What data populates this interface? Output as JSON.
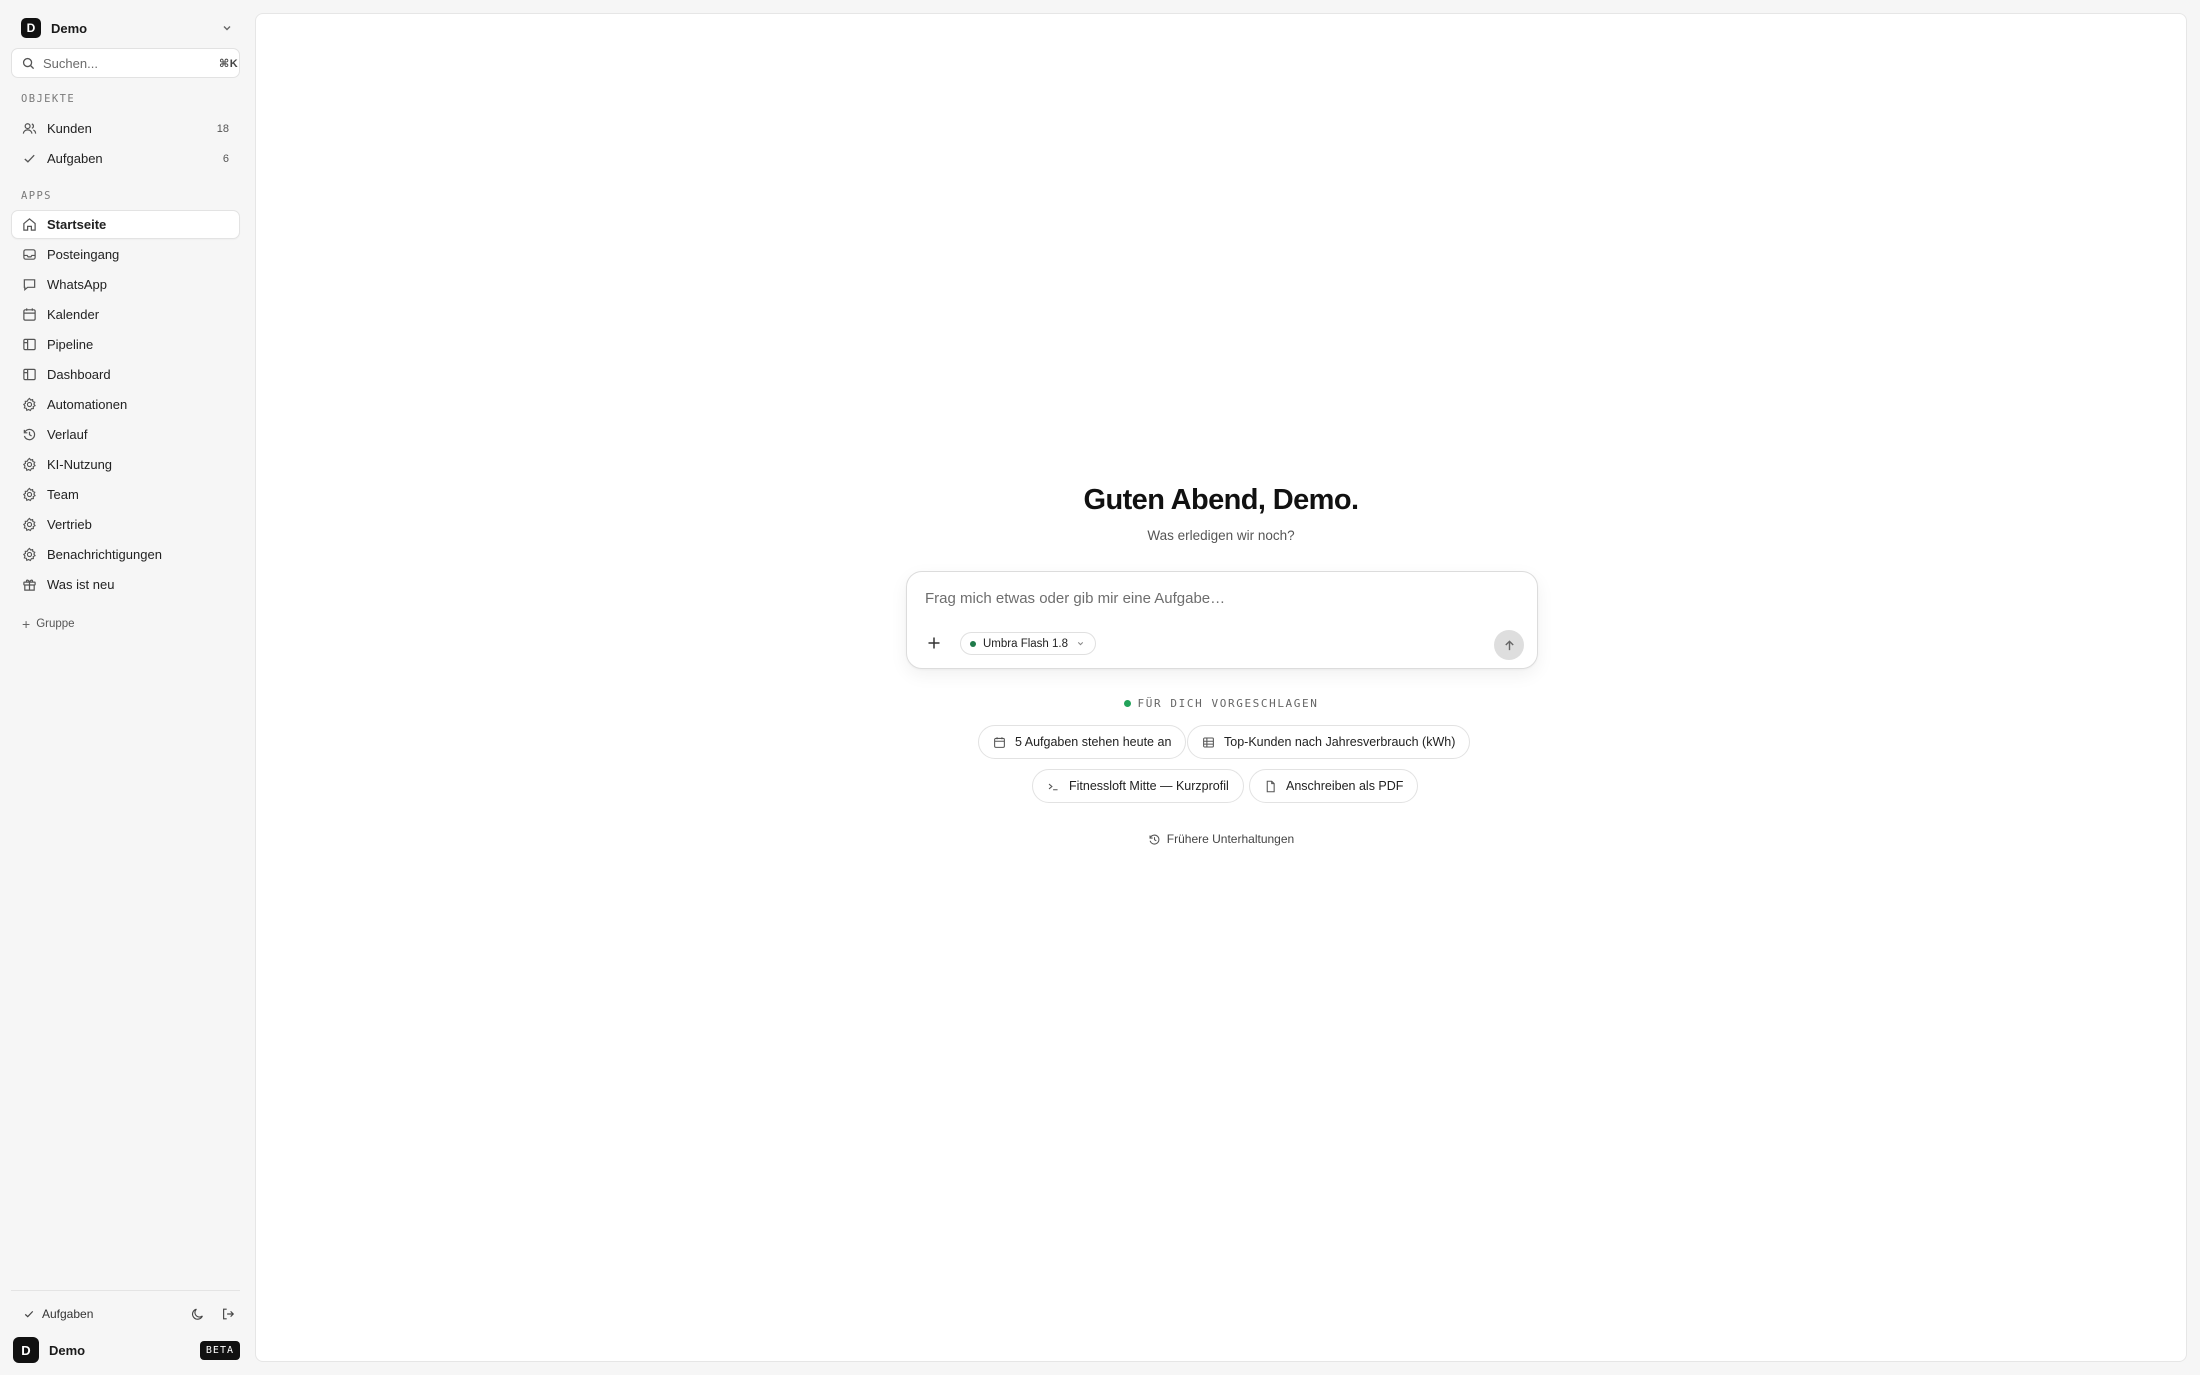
{
  "workspace": {
    "avatar_letter": "D",
    "name": "Demo"
  },
  "search": {
    "placeholder": "Suchen...",
    "shortcut": "⌘K"
  },
  "sections": {
    "objects": "OBJEKTE",
    "apps": "APPS"
  },
  "objects": [
    {
      "label": "Kunden",
      "count": "18",
      "icon": "users-icon"
    },
    {
      "label": "Aufgaben",
      "count": "6",
      "icon": "check-icon"
    }
  ],
  "apps": [
    {
      "label": "Startseite",
      "icon": "home-icon",
      "active": true
    },
    {
      "label": "Posteingang",
      "icon": "inbox-icon"
    },
    {
      "label": "WhatsApp",
      "icon": "chat-icon"
    },
    {
      "label": "Kalender",
      "icon": "calendar-icon"
    },
    {
      "label": "Pipeline",
      "icon": "layout-icon"
    },
    {
      "label": "Dashboard",
      "icon": "layout-icon"
    },
    {
      "label": "Automationen",
      "icon": "gear-icon"
    },
    {
      "label": "Verlauf",
      "icon": "history-icon"
    },
    {
      "label": "KI-Nutzung",
      "icon": "gear-icon"
    },
    {
      "label": "Team",
      "icon": "gear-icon"
    },
    {
      "label": "Vertrieb",
      "icon": "gear-icon"
    },
    {
      "label": "Benachrichtigungen",
      "icon": "gear-icon"
    },
    {
      "label": "Was ist neu",
      "icon": "gift-icon"
    }
  ],
  "add_group_label": "Gruppe",
  "footer": {
    "tasks_label": "Aufgaben",
    "user_letter": "D",
    "user_name": "Demo",
    "badge": "BETA"
  },
  "main": {
    "greeting": "Guten Abend, Demo.",
    "subtitle": "Was erledigen wir noch?",
    "composer_placeholder": "Frag mich etwas oder gib mir eine Aufgabe…",
    "model_name": "Umbra Flash 1.8",
    "suggestions_label": "FÜR DICH VORGESCHLAGEN",
    "suggestions": [
      {
        "label": "5 Aufgaben stehen heute an",
        "icon": "calendar-icon"
      },
      {
        "label": "Top-Kunden nach Jahresverbrauch (kWh)",
        "icon": "table-icon"
      },
      {
        "label": "Fitnessloft Mitte — Kurzprofil",
        "icon": "terminal-icon"
      },
      {
        "label": "Anschreiben als PDF",
        "icon": "file-icon"
      }
    ],
    "history_label": "Frühere Unterhaltungen"
  },
  "colors": {
    "accent_green": "#22a35a",
    "model_dot": "#1f7a4a",
    "dark": "#111111",
    "background": "#f6f6f6"
  }
}
